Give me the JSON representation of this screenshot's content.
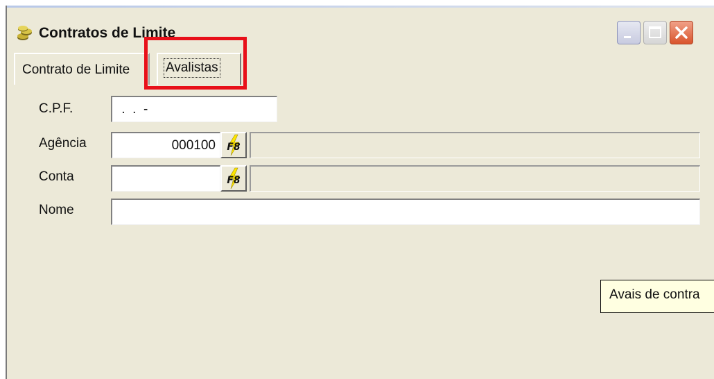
{
  "window": {
    "title": "Contratos de Limite"
  },
  "tabs": [
    {
      "label": "Contrato de Limite",
      "selected": false
    },
    {
      "label": "Avalistas",
      "selected": true
    }
  ],
  "form": {
    "cpf": {
      "label": "C.P.F.",
      "value": " .  .  -"
    },
    "agencia": {
      "label": "Agência",
      "value": "000100",
      "lookup_button": "F8",
      "description": ""
    },
    "conta": {
      "label": "Conta",
      "value": "",
      "lookup_button": "F8",
      "description": ""
    },
    "nome": {
      "label": "Nome",
      "value": ""
    }
  },
  "tooltip": {
    "text": "Avais de contra"
  },
  "colors": {
    "window_face": "#ece9d8",
    "highlight_box": "#e8101a",
    "tooltip_bg": "#ffffe1",
    "f8_bolt": "#ffe600"
  },
  "icons": {
    "app": "coins-icon",
    "minimize": "minimize-icon",
    "maximize": "maximize-icon",
    "close": "close-icon",
    "lookup": "f8-lookup-icon"
  }
}
